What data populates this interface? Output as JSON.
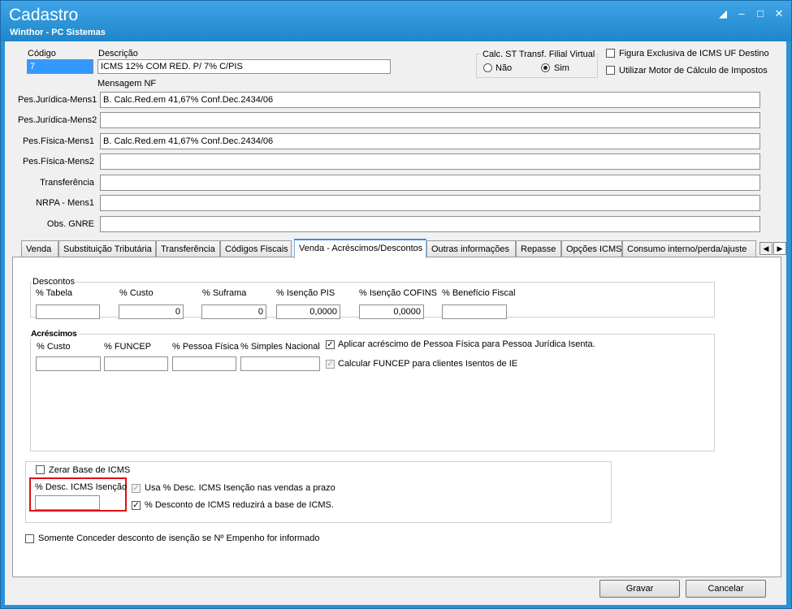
{
  "window": {
    "title": "Cadastro",
    "subtitle": "Winthor - PC Sistemas"
  },
  "header": {
    "codigo_label": "Código",
    "codigo_value": "7",
    "descricao_label": "Descrição",
    "descricao_value": "ICMS 12% COM RED. P/ 7% C/PIS",
    "calc_st_label": "Calc. ST Transf. Filial Virtual",
    "radio_nao": "Não",
    "radio_sim": "Sim",
    "radio_selected": "Sim",
    "figura_exclusiva": "Figura Exclusiva de ICMS UF Destino",
    "utilizar_motor": "Utilizar Motor de Cálculo de Impostos",
    "mensagem_nf_label": "Mensagem NF"
  },
  "messages": [
    {
      "label": "Pes.Jurídica-Mens1",
      "value": "B. Calc.Red.em 41,67% Conf.Dec.2434/06"
    },
    {
      "label": "Pes.Jurídica-Mens2",
      "value": ""
    },
    {
      "label": "Pes.Física-Mens1",
      "value": "B. Calc.Red.em 41,67% Conf.Dec.2434/06"
    },
    {
      "label": "Pes.Física-Mens2",
      "value": ""
    },
    {
      "label": "Transferência",
      "value": ""
    },
    {
      "label": "NRPA - Mens1",
      "value": ""
    },
    {
      "label": "Obs. GNRE",
      "value": ""
    }
  ],
  "tabs": [
    "Venda",
    "Substituição Tributária",
    "Transferência",
    "Códigos Fiscais",
    "Venda - Acréscimos/Descontos",
    "Outras informações",
    "Repasse",
    "Opções ICMS",
    "Consumo interno/perda/ajuste"
  ],
  "active_tab": "Venda - Acréscimos/Descontos",
  "descontos": {
    "title": "Descontos",
    "fields": [
      {
        "label": "% Tabela",
        "value": ""
      },
      {
        "label": "% Custo",
        "value": "0"
      },
      {
        "label": "% Suframa",
        "value": "0"
      },
      {
        "label": "% Isenção PIS",
        "value": "0,0000"
      },
      {
        "label": "% Isenção COFINS",
        "value": "0,0000"
      },
      {
        "label": "% Benefício Fiscal",
        "value": ""
      }
    ]
  },
  "acrescimos": {
    "title": "Acréscimos",
    "fields": [
      {
        "label": "% Custo",
        "value": ""
      },
      {
        "label": "% FUNCEP",
        "value": ""
      },
      {
        "label": "% Pessoa Física",
        "value": ""
      },
      {
        "label": "% Simples Nacional",
        "value": ""
      }
    ],
    "aplicar_label": "Aplicar acréscimo de Pessoa Física para Pessoa Jurídica Isenta.",
    "aplicar_checked": true,
    "calcular_label": "Calcular FUNCEP para clientes Isentos de IE",
    "calcular_checked": true
  },
  "icms": {
    "zerar_label": "Zerar Base de ICMS",
    "desc_isencao_label": "% Desc. ICMS Isenção",
    "desc_isencao_value": "",
    "usa_label": "Usa % Desc. ICMS Isenção nas vendas a prazo",
    "reduzira_label": "% Desconto de ICMS reduzirá a base de ICMS."
  },
  "somente_label": "Somente Conceder desconto de isenção se Nº Empenho for informado",
  "buttons": {
    "gravar": "Gravar",
    "cancelar": "Cancelar"
  }
}
